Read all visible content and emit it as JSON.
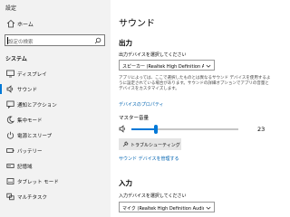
{
  "window": {
    "title": "設定"
  },
  "sidebar": {
    "home_label": "ホーム",
    "search_placeholder": "設定の検索",
    "section_title": "システム",
    "items": [
      {
        "label": "ディスプレイ",
        "icon": "display-icon"
      },
      {
        "label": "サウンド",
        "icon": "speaker-icon",
        "active": true
      },
      {
        "label": "通知とアクション",
        "icon": "notification-icon"
      },
      {
        "label": "集中モード",
        "icon": "moon-icon"
      },
      {
        "label": "電源とスリープ",
        "icon": "power-icon"
      },
      {
        "label": "バッテリー",
        "icon": "battery-icon"
      },
      {
        "label": "記憶域",
        "icon": "storage-icon"
      },
      {
        "label": "タブレット モード",
        "icon": "tablet-icon"
      },
      {
        "label": "マルチタスク",
        "icon": "multitask-icon"
      }
    ]
  },
  "main": {
    "title": "サウンド",
    "output": {
      "heading": "出力",
      "select_label": "出力デバイスを選択してください",
      "device": "スピーカー (Realtek High Definition Au...",
      "note": "アプリによっては、ここで選択したものとは異なるサウンド デバイスを使用するように設定されている場合があります。サウンドの詳細オプションでアプリの音量とデバイスをカスタマイズします。",
      "device_properties_link": "デバイスのプロパティ",
      "master_volume_label": "マスター音量",
      "volume": 23,
      "troubleshoot_label": "トラブルシューティング",
      "manage_link": "サウンド デバイスを管理する"
    },
    "input": {
      "heading": "入力",
      "select_label": "入力デバイスを選択してください",
      "device": "マイク (Realtek High Definition Audio)"
    }
  },
  "colors": {
    "accent": "#0078d7",
    "link": "#0063b1",
    "sidebar_bg": "#f2f2f2"
  }
}
